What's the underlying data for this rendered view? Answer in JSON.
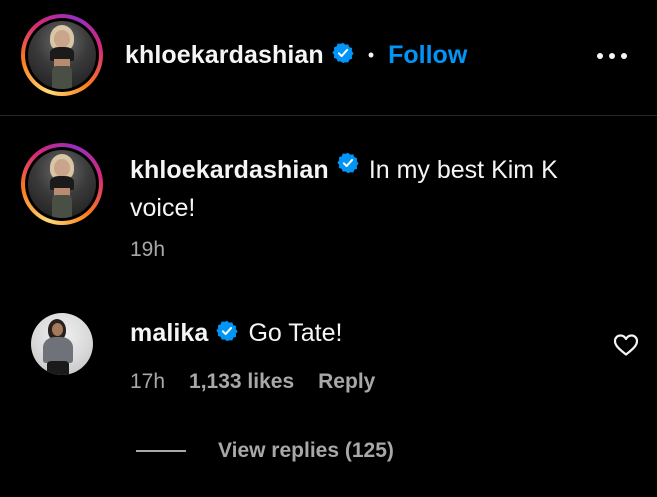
{
  "header": {
    "username": "khloekardashian",
    "separator": "•",
    "follow_label": "Follow",
    "more_icon": "more-horizontal-icon"
  },
  "caption": {
    "username": "khloekardashian",
    "text_line1": "In my best Kim K",
    "text_line2": "voice!",
    "time": "19h"
  },
  "comments": [
    {
      "username": "malika",
      "text": "Go Tate!",
      "time": "17h",
      "likes": "1,133 likes",
      "reply_label": "Reply",
      "like_icon": "heart-icon",
      "view_replies": "View replies (125)"
    }
  ],
  "colors": {
    "background": "#000000",
    "text": "#f5f5f5",
    "muted": "#a8a8a8",
    "link": "#0095f6",
    "verified": "#0095f6"
  }
}
